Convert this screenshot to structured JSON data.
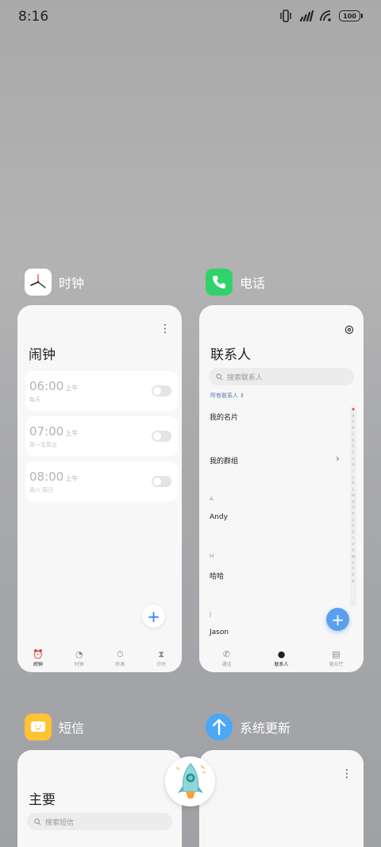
{
  "status": {
    "time": "8:16",
    "battery": "100"
  },
  "apps": {
    "clock": {
      "name": "时钟",
      "title": "闹钟",
      "alarms": [
        {
          "time": "06:00",
          "ampm": "上午",
          "repeat": "每天"
        },
        {
          "time": "07:00",
          "ampm": "上午",
          "repeat": "周一至周五"
        },
        {
          "time": "08:00",
          "ampm": "上午",
          "repeat": "周六 周日"
        }
      ],
      "add_label": "+",
      "tabs": [
        "闹钟",
        "时钟",
        "秒表",
        "计时"
      ]
    },
    "phone": {
      "name": "电话",
      "title": "联系人",
      "search_placeholder": "搜索联系人",
      "filter": "所有联系人 ⇕",
      "my_card": "我的名片",
      "my_groups": "我的群组",
      "sections": [
        {
          "letter": "A",
          "name": "Andy"
        },
        {
          "letter": "H",
          "name": "哈哈"
        },
        {
          "letter": "J",
          "name": "Jason"
        }
      ],
      "index_letters": [
        "♥",
        "#",
        "A",
        "B",
        "C",
        "D",
        "E",
        "F",
        "G",
        "H",
        "I",
        "J",
        "K",
        "L",
        "M",
        "N",
        "O",
        "P",
        "Q",
        "R",
        "S",
        "T",
        "U",
        "V",
        "W",
        "X",
        "Y",
        "Z",
        "#"
      ],
      "add_label": "+",
      "tabs": [
        "通话",
        "联系人",
        "营业厅"
      ]
    },
    "sms": {
      "name": "短信",
      "title": "主要",
      "search_placeholder": "搜索短信"
    },
    "update": {
      "name": "系统更新"
    }
  },
  "colors": {
    "phone_green": "#2fd36a",
    "sms_yellow": "#ffc233",
    "update_blue": "#4aa8f5",
    "accent_blue": "#2f7ff0"
  }
}
